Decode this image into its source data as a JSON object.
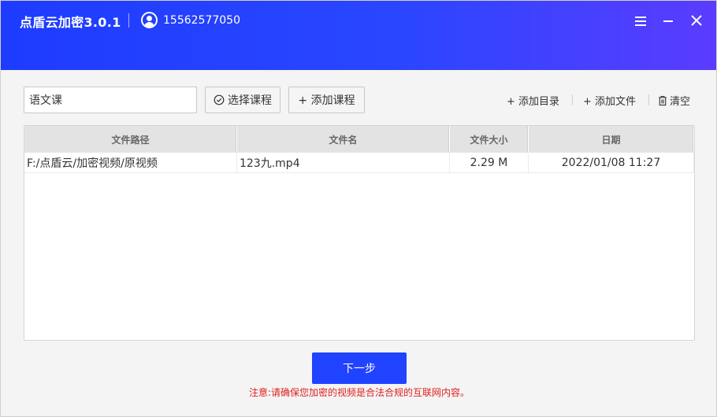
{
  "header": {
    "title": "点盾云加密3.0.1",
    "account": "15562577050"
  },
  "toolbar": {
    "course_input_value": "语文课",
    "select_course_label": "选择课程",
    "add_course_label": "+ 添加课程",
    "add_dir_label": "+ 添加目录",
    "add_file_label": "+ 添加文件",
    "clear_label": "清空"
  },
  "table": {
    "columns": [
      "文件路径",
      "文件名",
      "文件大小",
      "日期"
    ],
    "rows": [
      {
        "path": "F:/点盾云/加密视频/原视频",
        "name": "123九.mp4",
        "size": "2.29 M",
        "date": "2022/01/08 11:27"
      }
    ]
  },
  "footer": {
    "next_label": "下一步",
    "notice": "注意:请确保您加密的视频是合法合规的互联网内容。"
  },
  "colors": {
    "header_gradient_start": "#1e3cff",
    "header_gradient_end": "#5a3cff",
    "primary_button": "#2043ff",
    "notice_text": "#e01e1e"
  },
  "icons": {
    "account": "user-circle-icon",
    "menu": "hamburger-icon",
    "minimize": "minimize-icon",
    "close": "close-icon",
    "select": "check-circle-icon",
    "clear": "trash-icon"
  }
}
